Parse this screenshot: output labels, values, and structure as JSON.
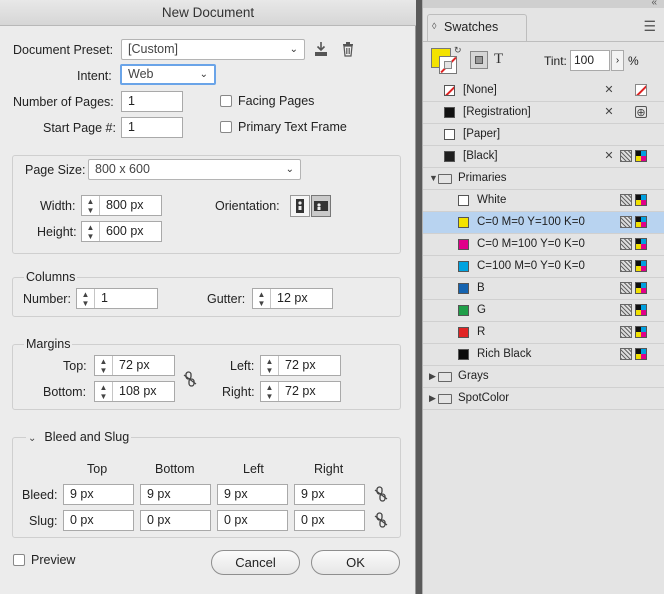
{
  "dialog": {
    "title": "New Document",
    "preset": {
      "label": "Document Preset:",
      "value": "[Custom]"
    },
    "intent": {
      "label": "Intent:",
      "value": "Web"
    },
    "pages": {
      "label": "Number of Pages:",
      "value": "1"
    },
    "start_page": {
      "label": "Start Page #:",
      "value": "1"
    },
    "facing_pages": {
      "label": "Facing Pages",
      "checked": false
    },
    "primary_text_frame": {
      "label": "Primary Text Frame",
      "checked": false
    },
    "page_size": {
      "label": "Page Size:",
      "value": "800 x 600"
    },
    "width": {
      "label": "Width:",
      "value": "800 px"
    },
    "height": {
      "label": "Height:",
      "value": "600 px"
    },
    "orientation": {
      "label": "Orientation:",
      "selected": "landscape"
    },
    "columns": {
      "title": "Columns",
      "number_label": "Number:",
      "number_value": "1",
      "gutter_label": "Gutter:",
      "gutter_value": "12 px"
    },
    "margins": {
      "title": "Margins",
      "top_label": "Top:",
      "top_value": "72 px",
      "bottom_label": "Bottom:",
      "bottom_value": "108 px",
      "left_label": "Left:",
      "left_value": "72 px",
      "right_label": "Right:",
      "right_value": "72 px"
    },
    "bleed_slug": {
      "title": "Bleed and Slug",
      "headers": [
        "Top",
        "Bottom",
        "Left",
        "Right"
      ],
      "bleed_label": "Bleed:",
      "bleed": [
        "9 px",
        "9 px",
        "9 px",
        "9 px"
      ],
      "slug_label": "Slug:",
      "slug": [
        "0 px",
        "0 px",
        "0 px",
        "0 px"
      ]
    },
    "preview": {
      "label": "Preview",
      "checked": false
    },
    "cancel_label": "Cancel",
    "ok_label": "OK"
  },
  "panel": {
    "tab_label": "Swatches",
    "tint_label": "Tint:",
    "tint_value": "100",
    "tint_unit": "%",
    "text_toggle": "T",
    "fill_color": "#f4e300",
    "swatches": [
      {
        "name": "[None]",
        "color": "none",
        "kind": "none"
      },
      {
        "name": "[Registration]",
        "color": "#111111",
        "kind": "registration"
      },
      {
        "name": "[Paper]",
        "color": "#ffffff",
        "kind": "paper"
      },
      {
        "name": "[Black]",
        "color": "#1e1e1e",
        "kind": "black"
      },
      {
        "name": "Primaries",
        "kind": "folder"
      },
      {
        "name": "White",
        "color": "#ffffff",
        "kind": "child"
      },
      {
        "name": "C=0 M=0 Y=100 K=0",
        "color": "#f4e300",
        "kind": "child",
        "selected": true
      },
      {
        "name": "C=0 M=100 Y=0 K=0",
        "color": "#e0008a",
        "kind": "child"
      },
      {
        "name": "C=100 M=0 Y=0 K=0",
        "color": "#00a3e0",
        "kind": "child"
      },
      {
        "name": "B",
        "color": "#1463b0",
        "kind": "child"
      },
      {
        "name": "G",
        "color": "#1f9e48",
        "kind": "child"
      },
      {
        "name": "R",
        "color": "#e02424",
        "kind": "child"
      },
      {
        "name": "Rich Black",
        "color": "#0b0b0b",
        "kind": "child"
      },
      {
        "name": "Grays",
        "kind": "folder-closed"
      },
      {
        "name": "SpotColor",
        "kind": "folder-closed"
      }
    ]
  }
}
